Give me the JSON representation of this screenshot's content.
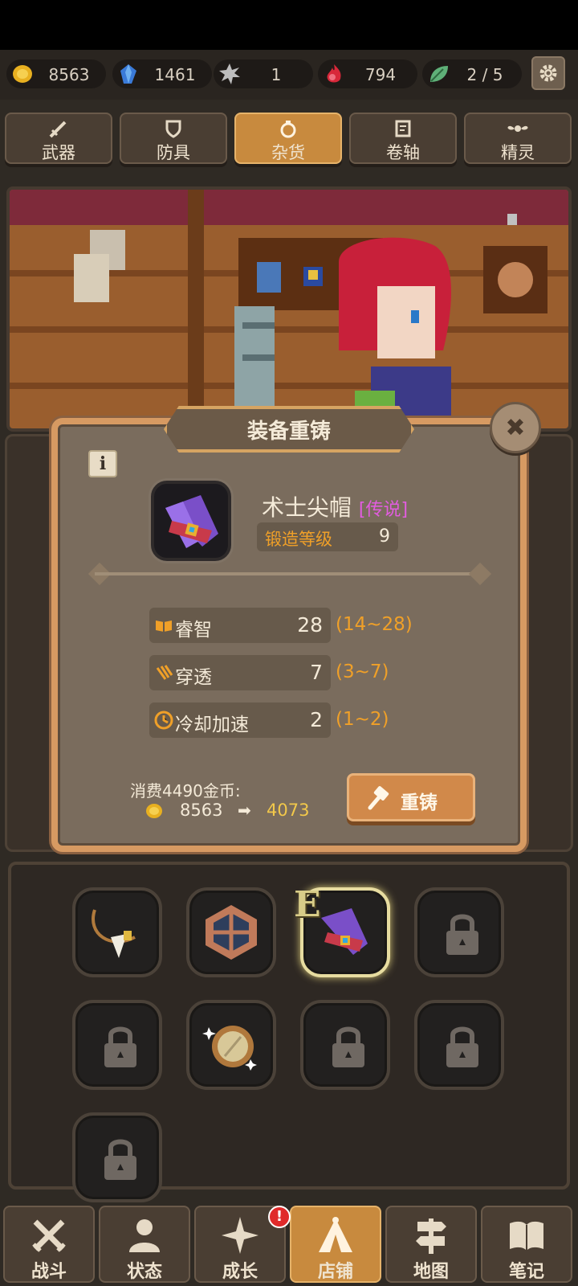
{
  "currencies": [
    {
      "name": "gold-coin-icon",
      "value": "8563"
    },
    {
      "name": "blue-gem-icon",
      "value": "1461"
    },
    {
      "name": "gear-shard-icon",
      "value": "1"
    },
    {
      "name": "red-flame-icon",
      "value": "794"
    },
    {
      "name": "leaf-icon",
      "value": "2 / 5"
    }
  ],
  "category_tabs": [
    {
      "label": "武器",
      "icon": "sword-icon"
    },
    {
      "label": "防具",
      "icon": "shield-icon"
    },
    {
      "label": "杂货",
      "icon": "ring-icon",
      "active": true
    },
    {
      "label": "卷轴",
      "icon": "scroll-icon"
    },
    {
      "label": "精灵",
      "icon": "wings-icon"
    }
  ],
  "modal": {
    "title": "装备重铸",
    "item_name": "术士尖帽",
    "item_rarity": "[传说]",
    "forge_label": "锻造等级",
    "forge_level": "9",
    "stats": [
      {
        "icon": "book-icon",
        "name": "睿智",
        "value": "28",
        "range": "(14~28)"
      },
      {
        "icon": "claw-icon",
        "name": "穿透",
        "value": "7",
        "range": "(3~7)"
      },
      {
        "icon": "cooldown-icon",
        "name": "冷却加速",
        "value": "2",
        "range": "(1~2)"
      }
    ],
    "cost_label": "消费4490金币:",
    "gold_before": "8563",
    "arrow": "➡",
    "gold_after": "4073",
    "reforge_label": "重铸",
    "info_glyph": "i",
    "close_glyph": "✖"
  },
  "inventory": {
    "equipped_mark": "E",
    "slots": [
      {
        "item": "fang-necklace",
        "locked": false
      },
      {
        "item": "rune-shield",
        "locked": false
      },
      {
        "item": "warlock-hat",
        "locked": false,
        "equipped": true
      },
      {
        "item": "locked-item",
        "locked": true
      },
      {
        "item": "locked-item",
        "locked": true
      },
      {
        "item": "sparkle-mirror",
        "locked": false
      },
      {
        "item": "locked-item",
        "locked": true
      },
      {
        "item": "locked-item",
        "locked": true
      },
      {
        "item": "locked-item",
        "locked": true
      }
    ]
  },
  "bottom_nav": [
    {
      "label": "战斗",
      "icon": "crossed-swords-icon"
    },
    {
      "label": "状态",
      "icon": "person-icon"
    },
    {
      "label": "成长",
      "icon": "sparkle-icon",
      "badge": "!"
    },
    {
      "label": "店铺",
      "icon": "tent-icon",
      "active": true
    },
    {
      "label": "地图",
      "icon": "signpost-icon"
    },
    {
      "label": "笔记",
      "icon": "open-book-icon"
    }
  ],
  "colors": {
    "accent_orange": "#f0a028",
    "rarity_legendary": "#e25ce0",
    "gold_after": "#f2c84a",
    "active_tab": "#c88a3e"
  }
}
